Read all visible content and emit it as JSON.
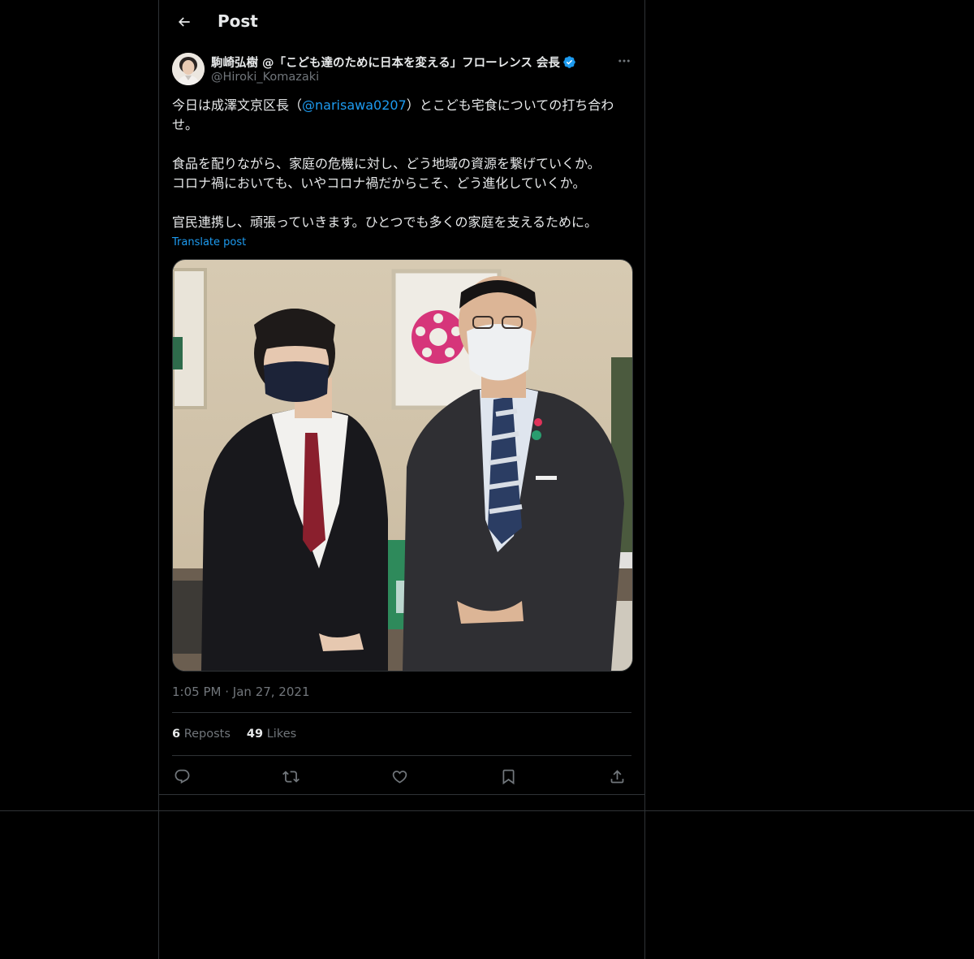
{
  "header": {
    "title": "Post"
  },
  "author": {
    "display_name": "駒崎弘樹 @「こども達のために日本を変える」フローレンス 会長",
    "handle": "@Hiroki_Komazaki",
    "verified": true
  },
  "post": {
    "line1_prefix": "今日は成澤文京区長（",
    "mention": "@narisawa0207",
    "line1_suffix": "）とこども宅食についての打ち合わせ。",
    "paragraph2_line1": "食品を配りながら、家庭の危機に対し、どう地域の資源を繋げていくか。",
    "paragraph2_line2": "コロナ禍においても、いやコロナ禍だからこそ、どう進化していくか。",
    "paragraph3": "官民連携し、頑張っていきます。ひとつでも多くの家庭を支えるために。",
    "translate_label": "Translate post",
    "time": "1:05 PM",
    "date_sep": "·",
    "date": "Jan 27, 2021"
  },
  "stats": {
    "reposts_count": "6",
    "reposts_label": "Reposts",
    "likes_count": "49",
    "likes_label": "Likes"
  },
  "icons": {
    "back": "arrow-left-icon",
    "more": "more-dots-icon",
    "reply": "reply-icon",
    "repost": "repost-icon",
    "like": "heart-icon",
    "bookmark": "bookmark-icon",
    "share": "share-icon"
  },
  "colors": {
    "background": "#000000",
    "text": "#e7e9ea",
    "secondary": "#71767b",
    "accent": "#1d9bf0",
    "border": "#2f3336"
  }
}
